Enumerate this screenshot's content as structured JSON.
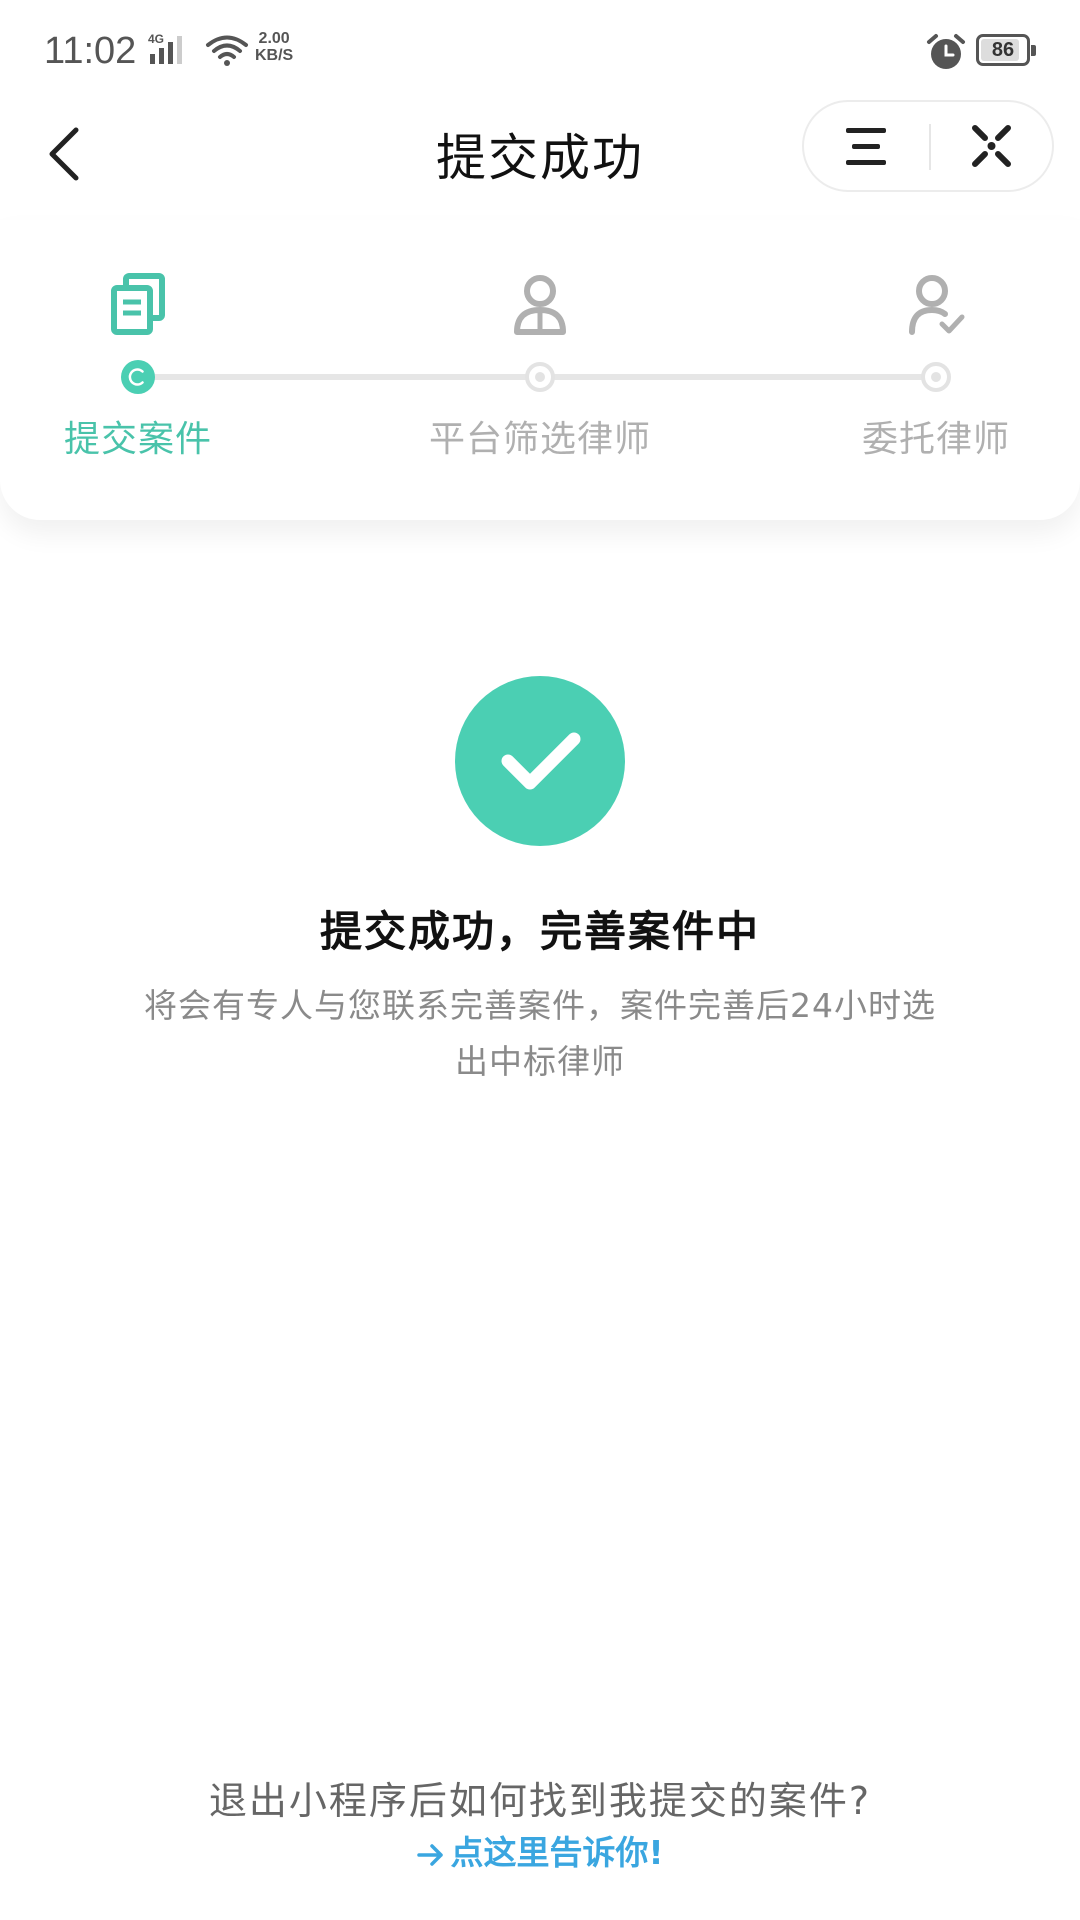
{
  "status_bar": {
    "time": "11:02",
    "network": "4G",
    "speed_value": "2.00",
    "speed_unit": "KB/S",
    "battery": "86",
    "battery_level": 0.86,
    "icons": [
      "signal-icon",
      "wifi-icon",
      "alarm-icon",
      "battery-icon"
    ]
  },
  "nav": {
    "title": "提交成功",
    "icons": [
      "back-icon",
      "menu-icon",
      "close-icon"
    ]
  },
  "steps": [
    {
      "label": "提交案件",
      "state": "active",
      "icon": "documents-icon"
    },
    {
      "label": "平台筛选律师",
      "state": "pending",
      "icon": "lawyer-icon"
    },
    {
      "label": "委托律师",
      "state": "pending",
      "icon": "user-check-icon"
    }
  ],
  "result": {
    "icon": "checkmark-icon",
    "title": "提交成功，完善案件中",
    "description": "将会有专人与您联系完善案件，案件完善后24小时选出中标律师"
  },
  "footer": {
    "question": "退出小程序后如何找到我提交的案件?",
    "link": "点这里告诉你!",
    "link_icon": "arrow-right-icon"
  },
  "colors": {
    "accent": "#4bcfb3",
    "step_active_text": "#49c3aa",
    "step_inactive": "#b0b0b0",
    "link": "#3aa6e0"
  }
}
